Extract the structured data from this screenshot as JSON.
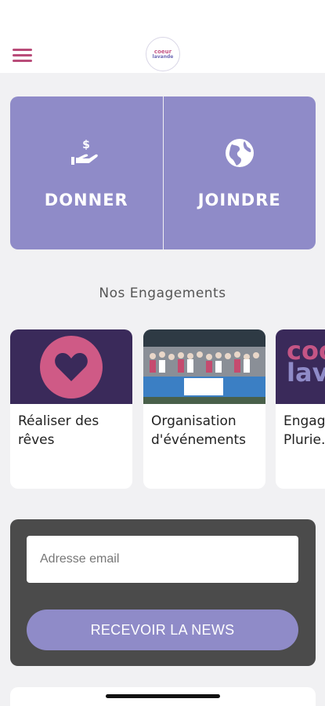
{
  "header": {
    "logo_line1": "coeur",
    "logo_line2": "lavande"
  },
  "actions": [
    {
      "label": "DONNER",
      "icon": "hand-dollar-icon"
    },
    {
      "label": "JOINDRE",
      "icon": "globe-icon"
    }
  ],
  "section": {
    "title": "Nos Engagements"
  },
  "cards": [
    {
      "caption": "Réaliser des rêves",
      "image": "heart-icon"
    },
    {
      "caption": "Organisation d'événements",
      "image": "event-photo"
    },
    {
      "caption": "Engag… Plurie…",
      "image_text_1": "coo",
      "image_text_2": "lav"
    }
  ],
  "newsletter": {
    "email_placeholder": "Adresse email",
    "button_label": "RECEVOIR LA NEWS"
  },
  "colors": {
    "accent_purple": "#8f8bc8",
    "accent_pink": "#cf5a86",
    "dark_panel": "#4b4b4b"
  }
}
